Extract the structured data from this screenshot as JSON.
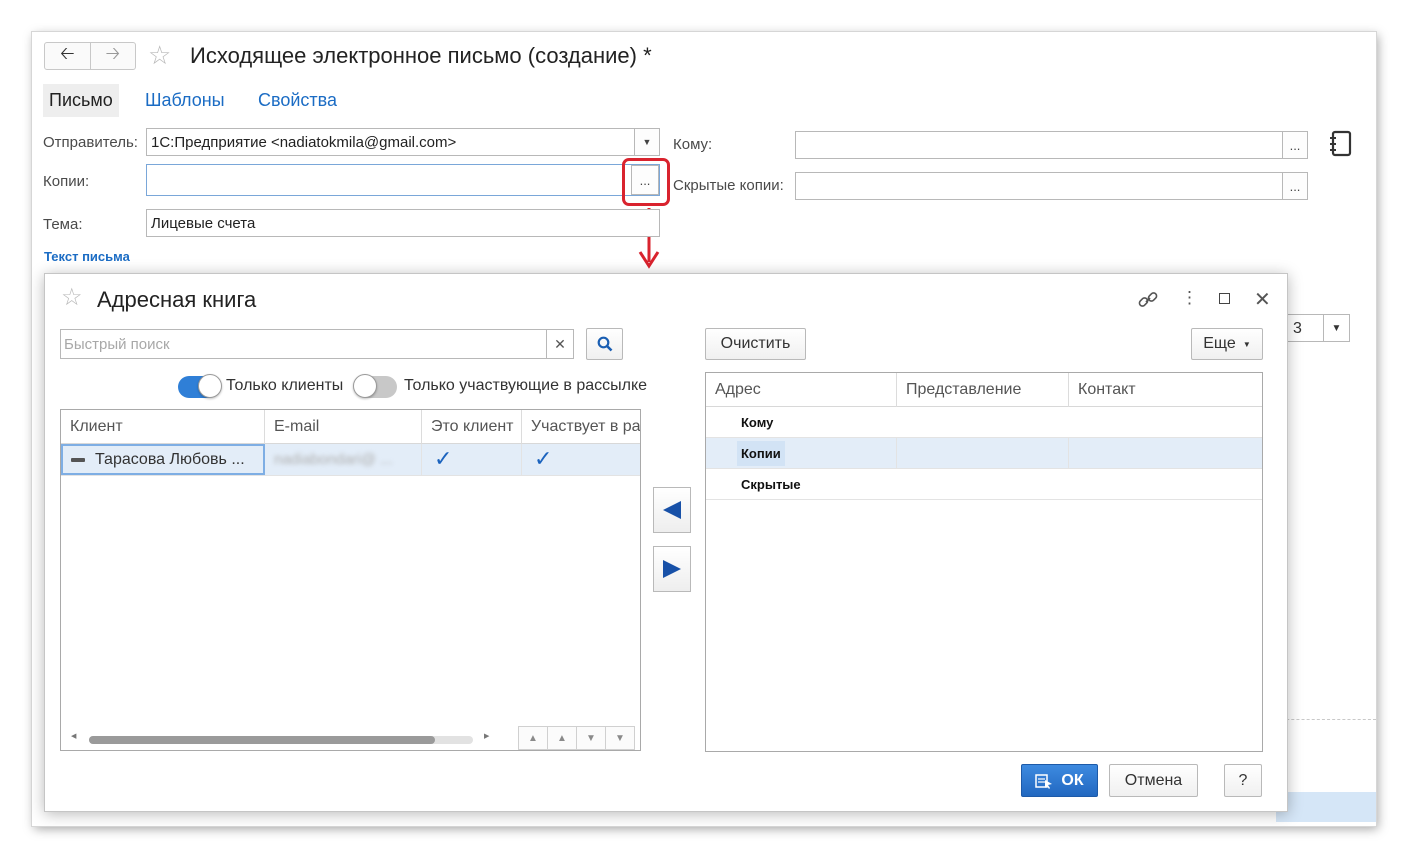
{
  "main": {
    "title": "Исходящее электронное письмо (создание) *",
    "tabs": [
      "Письмо",
      "Шаблоны",
      "Свойства"
    ],
    "sender_label": "Отправитель:",
    "sender_value": "1С:Предприятие <nadiatokmila@gmail.com>",
    "cc_label": "Копии:",
    "cc_value": "",
    "subject_label": "Тема:",
    "subject_value": "Лицевые счета",
    "to_label": "Кому:",
    "to_value": "",
    "bcc_label": "Скрытые копии:",
    "bcc_value": "",
    "body_section": "Текст письма",
    "ellipsis": "...",
    "bg_combo_value": "3"
  },
  "dialog": {
    "title": "Адресная книга",
    "search_placeholder": "Быстрый поиск",
    "clear_label": "Очистить",
    "more_label": "Еще",
    "toggle_clients": {
      "label": "Только клиенты",
      "on": true
    },
    "toggle_participants": {
      "label": "Только участвующие в рассылке",
      "on": false
    },
    "clients_table": {
      "columns": [
        "Клиент",
        "E-mail",
        "Это клиент",
        "Участвует в ра"
      ],
      "rows": [
        {
          "client": "Тарасова Любовь ...",
          "email": "nadiabondari@ ...",
          "is_client": "✓",
          "participates": "✓"
        }
      ]
    },
    "address_table": {
      "columns": [
        "Адрес",
        "Представление",
        "Контакт"
      ],
      "rows": [
        "Кому",
        "Копии",
        "Скрытые"
      ]
    },
    "ok_label": "ОК",
    "cancel_label": "Отмена",
    "help_label": "?"
  },
  "colors": {
    "accent": "#1b6cc4",
    "highlight": "#d9232e",
    "selection": "#e3edf8",
    "primary_button": "#2b77d2"
  }
}
